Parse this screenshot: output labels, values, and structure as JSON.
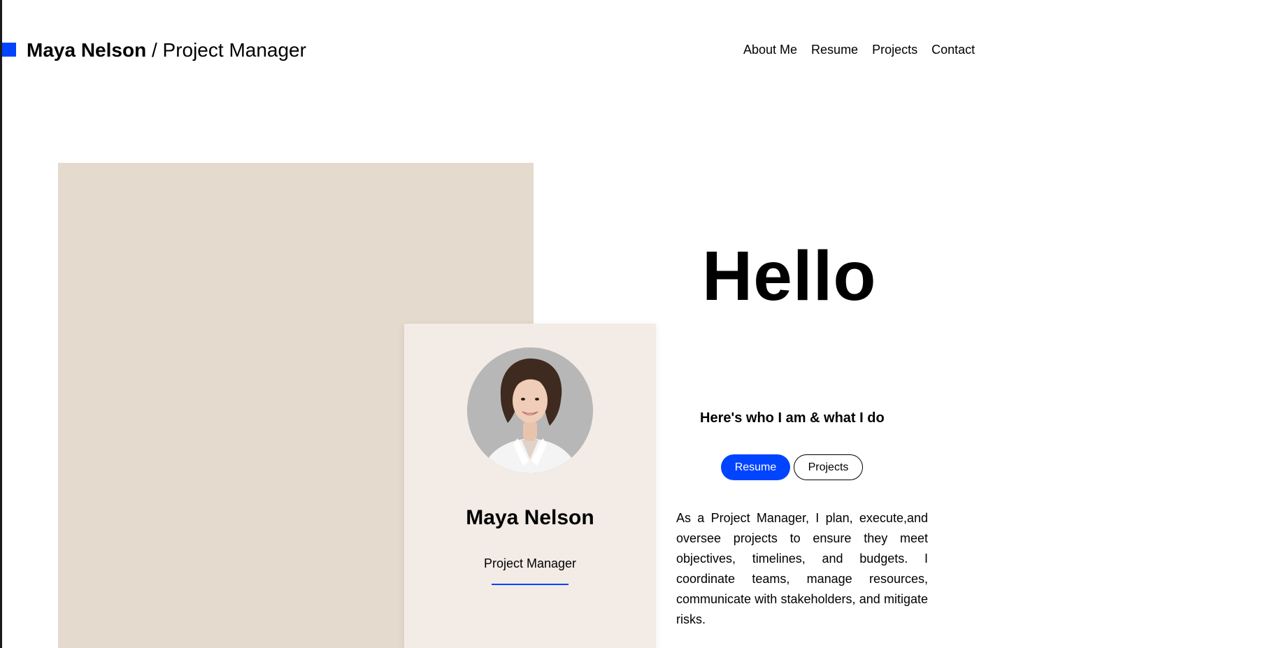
{
  "header": {
    "brand_name": "Maya Nelson",
    "brand_separator": " / ",
    "brand_role": "Project Manager",
    "brand_square_icon": "square-icon"
  },
  "nav": {
    "items": [
      {
        "label": "About Me"
      },
      {
        "label": "Resume"
      },
      {
        "label": "Projects"
      },
      {
        "label": "Contact"
      }
    ]
  },
  "profile_card": {
    "avatar": "portrait-photo",
    "name": "Maya Nelson",
    "role": "Project Manager"
  },
  "hero": {
    "heading": "Hello",
    "tagline": "Here's who I am & what I do",
    "primary_button": "Resume",
    "secondary_button": "Projects",
    "about_text": "As a Project Manager, I plan, execute,and oversee projects to ensure they meet objectives, timelines, and budgets. I coordinate teams, manage resources, communicate with stakeholders, and mitigate risks."
  },
  "colors": {
    "accent": "#0044ff",
    "hero_block": "#e4dacd",
    "card_bg": "#f3ece6",
    "text": "#000000",
    "left_rule": "#1a1a1a"
  }
}
